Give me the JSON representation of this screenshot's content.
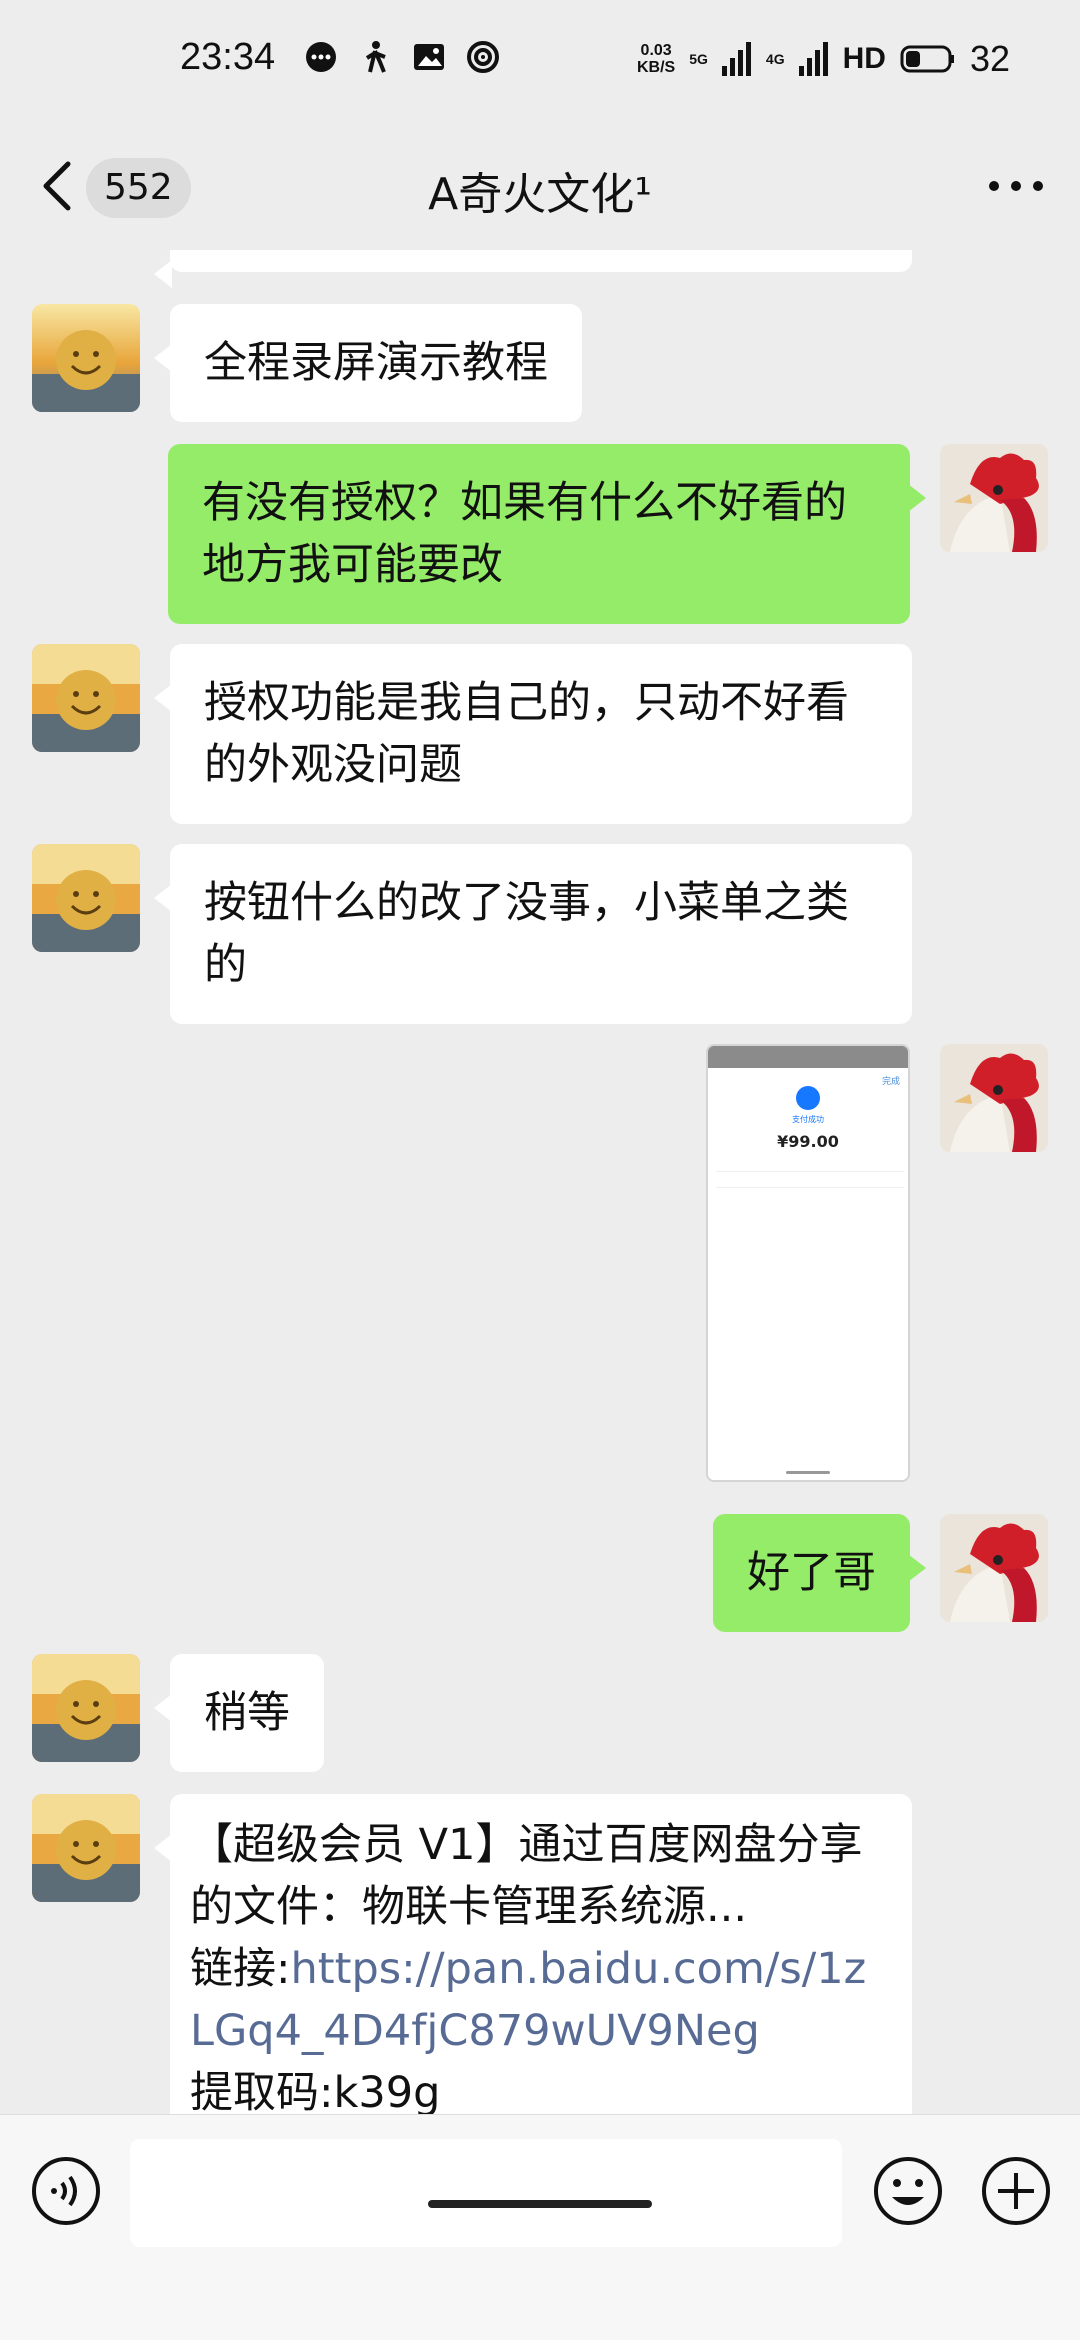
{
  "status_bar": {
    "time": "23:34",
    "speed_top": "0.03",
    "speed_bottom": "KB/S",
    "signal_5g": "5G",
    "signal_4g": "4G",
    "hd": "HD",
    "battery": "32"
  },
  "header": {
    "unread_count": "552",
    "title": "A奇火文化¹"
  },
  "messages": [
    {
      "side": "in",
      "text": "全程录屏演示教程"
    },
    {
      "side": "out",
      "text": "有没有授权？如果有什么不好看的地方我可能要改"
    },
    {
      "side": "in",
      "text": "授权功能是我自己的，只动不好看的外观没问题"
    },
    {
      "side": "in",
      "text": "按钮什么的改了没事，小菜单之类的"
    },
    {
      "side": "out",
      "type": "image",
      "image_amount": "¥99.00",
      "image_done": "完成",
      "image_sub": "支付成功"
    },
    {
      "side": "out",
      "text": "好了哥"
    },
    {
      "side": "in",
      "text": "稍等"
    },
    {
      "side": "in",
      "text_prefix": "【超级会员 V1】通过百度网盘分享的文件：物联卡管理系统源...",
      "link_label": "链接:",
      "link": "https://pan.baidu.com/s/1zLGq4_4D4fjC879wUV9Neg",
      "code": "提取码:k39g"
    }
  ],
  "input": {
    "placeholder": ""
  },
  "colors": {
    "accent_out_bubble": "#95ec69",
    "in_bubble": "#ffffff",
    "link": "#576b95",
    "background": "#ededed"
  }
}
